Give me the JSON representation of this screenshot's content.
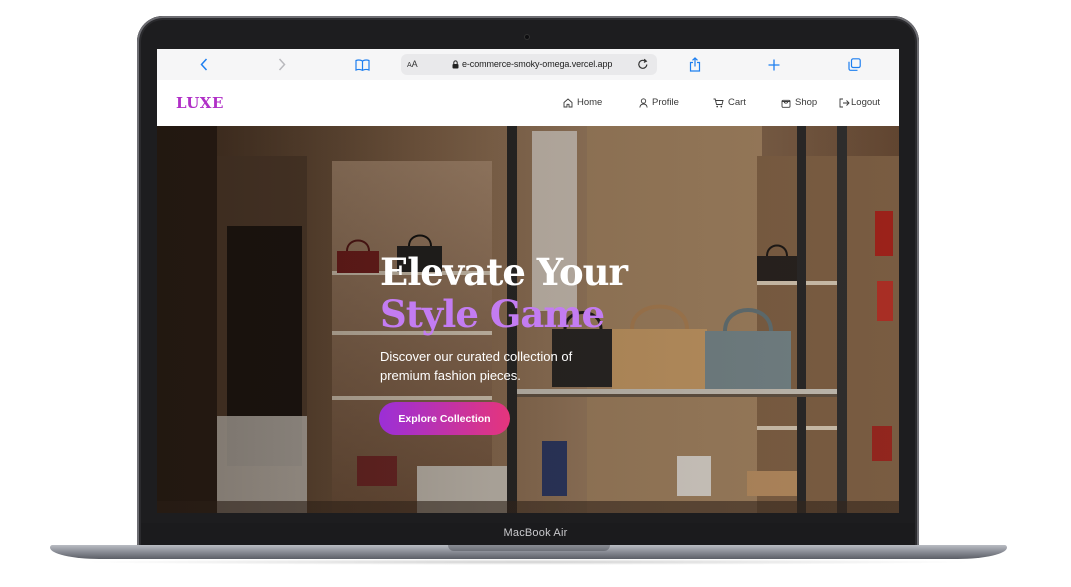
{
  "device": {
    "label": "MacBook Air"
  },
  "browser": {
    "text_size_label": "AA",
    "url": "e-commerce-smoky-omega.vercel.app"
  },
  "site": {
    "logo": "LUXE",
    "nav": [
      {
        "label": "Home",
        "icon": "home-icon"
      },
      {
        "label": "Profile",
        "icon": "user-icon"
      },
      {
        "label": "Cart",
        "icon": "cart-icon"
      },
      {
        "label": "Shop",
        "icon": "shopping-bag-icon"
      },
      {
        "label": "Logout",
        "icon": "logout-icon"
      }
    ]
  },
  "hero": {
    "title_line1": "Elevate Your",
    "title_line2": "Style Game",
    "subtitle": "Discover our curated collection of premium fashion pieces.",
    "cta_label": "Explore Collection"
  },
  "colors": {
    "brand": "#b02fc7",
    "accent_purple": "#c37cf2",
    "cta_gradient_start": "#9b2fd7",
    "cta_gradient_end": "#e5357c",
    "browser_blue": "#1e7ff0"
  }
}
